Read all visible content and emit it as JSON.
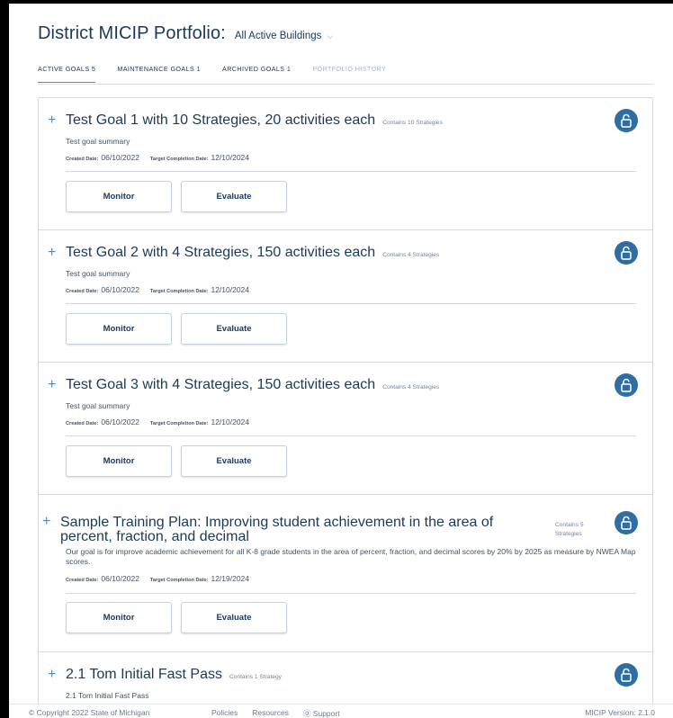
{
  "header": {
    "title": "District MICIP Portfolio:",
    "building_select": "All Active Buildings"
  },
  "tabs": [
    {
      "label": "ACTIVE GOALS 5"
    },
    {
      "label": "MAINTENANCE GOALS 1"
    },
    {
      "label": "ARCHIVED GOALS 1"
    },
    {
      "label": "PORTFOLIO HISTORY"
    }
  ],
  "labels": {
    "created": "Created Date:",
    "target": "Target Completion Date:",
    "monitor": "Monitor",
    "evaluate": "Evaluate"
  },
  "goals": [
    {
      "title": "Test Goal 1 with 10 Strategies, 20 activities each",
      "contains": "Contains 10 Strategies",
      "summary": "Test goal summary",
      "created": "06/10/2022",
      "target": "12/10/2024"
    },
    {
      "title": "Test Goal 2 with 4 Strategies, 150 activities each",
      "contains": "Contains 4 Strategies",
      "summary": "Test goal summary",
      "created": "06/10/2022",
      "target": "12/10/2024"
    },
    {
      "title": "Test Goal 3 with 4 Strategies, 150 activities each",
      "contains": "Contains 4 Strategies",
      "summary": "Test goal summary",
      "created": "06/10/2022",
      "target": "12/10/2024"
    },
    {
      "title": "Sample Training Plan: Improving student achievement in the area of percent, fraction, and decimal",
      "contains": "Contains 5 Strategies",
      "summary": "Our goal is for improve academic achievement for all K-8 grade students in the area of percent, fraction, and decimal scores by 20% by 2025 as measure by NWEA Map scores.",
      "created": "06/10/2022",
      "target": "12/19/2024"
    },
    {
      "title": "2.1 Tom Initial Fast Pass",
      "contains": "Contains 1 Strategy",
      "summary": "2.1 Tom Initial Fast Pass"
    }
  ],
  "footer": {
    "copyright": "© Copyright 2022 State of Michigan",
    "policies": "Policies",
    "resources": "Resources",
    "support": "⓪ Support",
    "version": "MICIP Version: 2.1.0"
  }
}
